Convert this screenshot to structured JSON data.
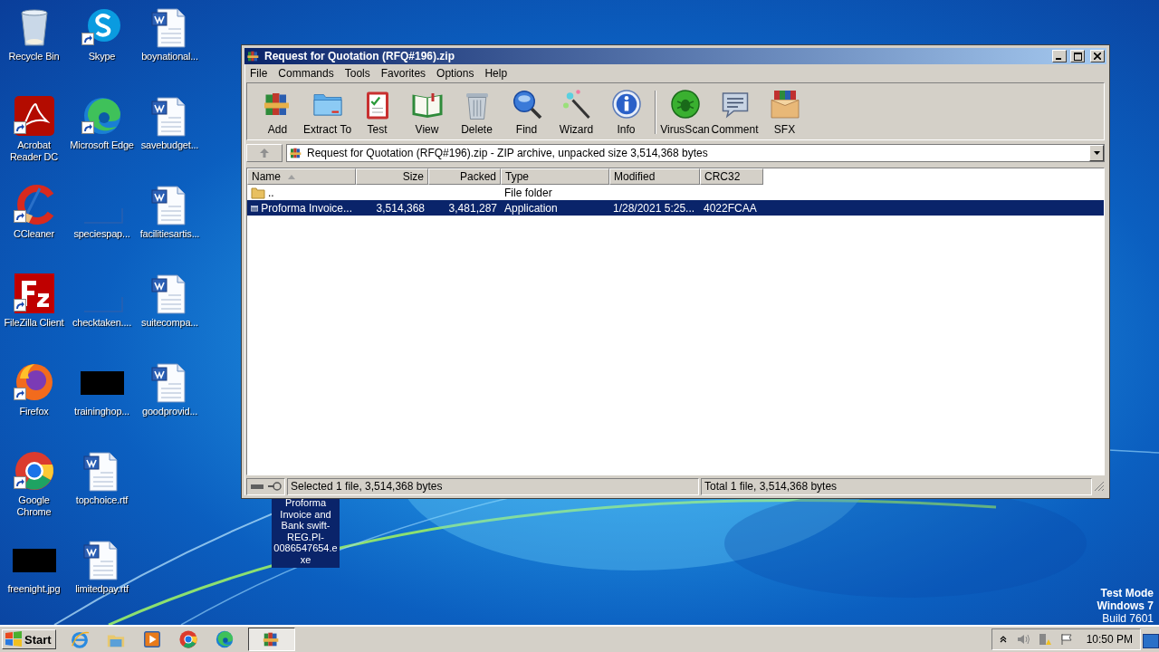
{
  "desktop": {
    "columns": [
      [
        {
          "label": "Recycle Bin",
          "kind": "recycle",
          "shortcut": false
        },
        {
          "label": "Acrobat Reader DC",
          "kind": "acrobat",
          "shortcut": true
        },
        {
          "label": "CCleaner",
          "kind": "ccleaner",
          "shortcut": true
        },
        {
          "label": "FileZilla Client",
          "kind": "filezilla",
          "shortcut": true
        },
        {
          "label": "Firefox",
          "kind": "firefox",
          "shortcut": true
        },
        {
          "label": "Google Chrome",
          "kind": "chrome",
          "shortcut": true
        },
        {
          "label": "freenight.jpg",
          "kind": "black",
          "shortcut": false
        }
      ],
      [
        {
          "label": "Skype",
          "kind": "skype",
          "shortcut": true
        },
        {
          "label": "Microsoft Edge",
          "kind": "edge",
          "shortcut": true
        },
        {
          "label": "speciespap...",
          "kind": "blank",
          "shortcut": false
        },
        {
          "label": "checktaken....",
          "kind": "blank",
          "shortcut": false
        },
        {
          "label": "traininghop...",
          "kind": "black",
          "shortcut": false
        },
        {
          "label": "topchoice.rtf",
          "kind": "word",
          "shortcut": false
        },
        {
          "label": "limitedpay.rtf",
          "kind": "word",
          "shortcut": false
        }
      ],
      [
        {
          "label": "boynational...",
          "kind": "word",
          "shortcut": false
        },
        {
          "label": "savebudget...",
          "kind": "word",
          "shortcut": false
        },
        {
          "label": "facilitiesartis...",
          "kind": "word",
          "shortcut": false
        },
        {
          "label": "suitecompa...",
          "kind": "word",
          "shortcut": false
        },
        {
          "label": "goodprovid...",
          "kind": "word",
          "shortcut": false
        }
      ]
    ],
    "drag_label": "Proforma Invoice and Bank swift-REG.PI-0086547654.exe",
    "system_notice": [
      "Test Mode",
      "Windows 7",
      "Build 7601"
    ]
  },
  "window": {
    "title": "Request for Quotation (RFQ#196).zip",
    "menu": [
      "File",
      "Commands",
      "Tools",
      "Favorites",
      "Options",
      "Help"
    ],
    "toolbar": [
      [
        {
          "label": "Add",
          "kind": "add"
        },
        {
          "label": "Extract To",
          "kind": "extract"
        },
        {
          "label": "Test",
          "kind": "test"
        },
        {
          "label": "View",
          "kind": "view"
        },
        {
          "label": "Delete",
          "kind": "delete"
        },
        {
          "label": "Find",
          "kind": "find"
        },
        {
          "label": "Wizard",
          "kind": "wizard"
        },
        {
          "label": "Info",
          "kind": "info"
        }
      ],
      [
        {
          "label": "VirusScan",
          "kind": "virusscan"
        },
        {
          "label": "Comment",
          "kind": "comment"
        },
        {
          "label": "SFX",
          "kind": "sfx"
        }
      ]
    ],
    "address": "Request for Quotation (RFQ#196).zip - ZIP archive, unpacked size 3,514,368 bytes",
    "columns": [
      {
        "label": "Name",
        "sorted": true
      },
      {
        "label": "Size",
        "sorted": false
      },
      {
        "label": "Packed",
        "sorted": false
      },
      {
        "label": "Type",
        "sorted": false
      },
      {
        "label": "Modified",
        "sorted": false
      },
      {
        "label": "CRC32",
        "sorted": false
      }
    ],
    "rows": [
      {
        "kind": "folder",
        "selected": false,
        "cells": [
          "..",
          "",
          "",
          "File folder",
          "",
          ""
        ]
      },
      {
        "kind": "app",
        "selected": true,
        "cells": [
          "Proforma Invoice...",
          "3,514,368",
          "3,481,287",
          "Application",
          "1/28/2021 5:25...",
          "4022FCAA"
        ]
      }
    ],
    "status": [
      "Selected 1 file, 3,514,368 bytes",
      "Total 1 file, 3,514,368 bytes"
    ]
  },
  "taskbar": {
    "start": "Start",
    "items": [
      {
        "kind": "ie",
        "selected": false
      },
      {
        "kind": "explorer",
        "selected": false
      },
      {
        "kind": "media",
        "selected": false
      },
      {
        "kind": "chrome",
        "selected": false
      },
      {
        "kind": "edge",
        "selected": false
      },
      {
        "kind": "archiver",
        "selected": true
      }
    ],
    "clock": "10:50 PM"
  }
}
